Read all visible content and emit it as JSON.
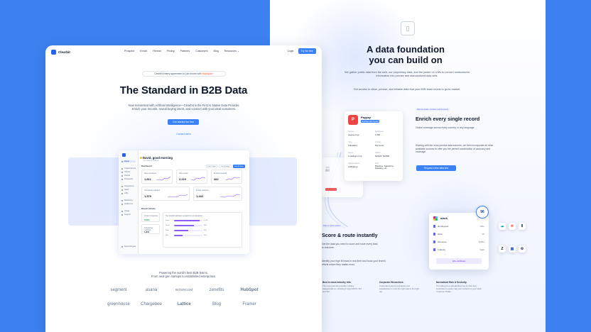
{
  "left_page": {
    "brand": "Clearbit",
    "nav": {
      "links": [
        "Prospect",
        "Enrich",
        "Reveal",
        "Pricing",
        "Partners",
        "Customers",
        "Blog",
        "Resources"
      ],
      "login": "Login",
      "cta": "Try for free"
    },
    "announcement": {
      "text": "Clearbit enters agreement to join forces with",
      "brand": "HubSpot"
    },
    "hero": {
      "title": "The Standard in B2B Data",
      "subtitle_line1": "Now reinvented with Artificial Intelligence—Clearbit is the First AI Native Data Provider.",
      "subtitle_line2": "Enrich your records, reveal buying intent, and connect with your ideal customers.",
      "cta": "Get started for free",
      "contact": "Contact sales"
    },
    "dashboard": {
      "greeting": "David, good morning",
      "greeting_sub": "Your data at a glance",
      "section_dashboard": "Dashboard",
      "section_reveal": "Reveal Activity",
      "ranges": [
        "Last 7 days",
        "Last 30 days",
        "Last 90 days"
      ],
      "sidebar": [
        "Home",
        "Organizations",
        "Visitors",
        "People",
        "Prospector",
        "Integrations",
        "Slack",
        "APIs",
        "Marketing",
        "Audiences",
        "Usage",
        "Support"
      ],
      "stats": [
        {
          "label": "New companies",
          "value": "1,811"
        },
        {
          "label": "New people",
          "value": "2,219"
        },
        {
          "label": "Enriched records",
          "value": "482"
        },
        {
          "label": "Companies matched",
          "value": "1,579"
        },
        {
          "label": "People matched",
          "value": "1,442"
        }
      ],
      "reveal_cards": [
        {
          "label": "Visited companies",
          "value": "146%"
        },
        {
          "label": "Companies matched",
          "value": "1,811"
        }
      ],
      "reveal_bars_label": "Top Clearbit pathways to leads for our categories",
      "reveal_bars": [
        {
          "name": "Email",
          "value": "1,200",
          "fill": 0.9
        },
        {
          "name": "SaaS",
          "value": "900",
          "fill": 0.7
        },
        {
          "name": "Web",
          "value": "600",
          "fill": 0.5
        },
        {
          "name": "Ads",
          "value": "300",
          "fill": 0.3
        }
      ],
      "user_name": "David Morgan"
    },
    "logos_title_line1": "Powering the world's best B2B teams.",
    "logos_title_line2": "From next-gen startups to established enterprises.",
    "customers": [
      "segment",
      "asana",
      "INTERCOM",
      "zenefits",
      "HubSpot",
      "greenhouse",
      "Chargebee",
      "Lattice",
      "Blog",
      "Framer"
    ]
  },
  "right_page": {
    "title_line1": "A data foundation",
    "title_line2": "you can build on",
    "subtitle": "We gather public data from the web, our proprietary data, and the power of LLMs to convert unstructured information into precise and standardized data sets.",
    "subtitle2": "Get access to clean, precise, and reliable data that your B2B team needs to go-to-market.",
    "company_card": {
      "name": "Paypay",
      "badge": "Enriched with Clearbit",
      "fields": [
        {
          "label": "Domain",
          "value": "paypay.ne.jp"
        },
        {
          "label": "Employees",
          "value": "1,250"
        },
        {
          "label": "Type",
          "value": "Subsidiary"
        },
        {
          "label": "Industry",
          "value": "Payments"
        },
        {
          "label": "Parent",
          "value": "z-holdings.co.jp"
        },
        {
          "label": "NAICS",
          "value": "522320, 522390"
        },
        {
          "label": "Ultimate Parent",
          "value": "softbank.jp"
        },
        {
          "label": "Tech",
          "value": "Braintree, Salesforce, Datadog, +11"
        }
      ]
    },
    "enrich": {
      "tag": "Data for leads, contacts, and accounts",
      "title": "Enrich every single record",
      "p1": "Global coverage across every country, in any language.",
      "p2": "Starting with the most precise data sources, we then incorporate all other available sources to offer you the perfect combination of accuracy and coverage.",
      "cta": "Request a free data test"
    },
    "score": {
      "tag": "Data on what matters",
      "title": "Score & route instantly",
      "p1": "Get the data you need to score and route every lead, in real-time.",
      "p2": "Identify your high fit leads in real time and focus your team's efforts where they matter most."
    },
    "slack": {
      "title": "slack",
      "rows": [
        {
          "label": "Employees",
          "value": "500+"
        },
        {
          "label": "Role",
          "value": "VP"
        },
        {
          "label": "Revenue",
          "value": "$10M+"
        },
        {
          "label": "Industry",
          "value": "SaaS"
        }
      ],
      "button": "100+ Attributes",
      "score": "96"
    },
    "features": [
      {
        "title": "Best in class Industry Info.",
        "text": "The most granular possible industry categorizations, including 6 digit NAICS, SIC, and SIC."
      },
      {
        "title": "Corporate Hierarchies.",
        "text": "Understand parent companies and subsidiaries to route the right lead to the right rep."
      },
      {
        "title": "Normalized Role & Seniority.",
        "text": "Turn titles into a standardized set of roles and seniorities to easily map your contacts to your Ideal Customer Profile."
      }
    ]
  },
  "colors": {
    "background": "#3b82f0",
    "accent": "#3b82f6",
    "purple": "#8b5cf6",
    "paypay": "#ef4444"
  }
}
